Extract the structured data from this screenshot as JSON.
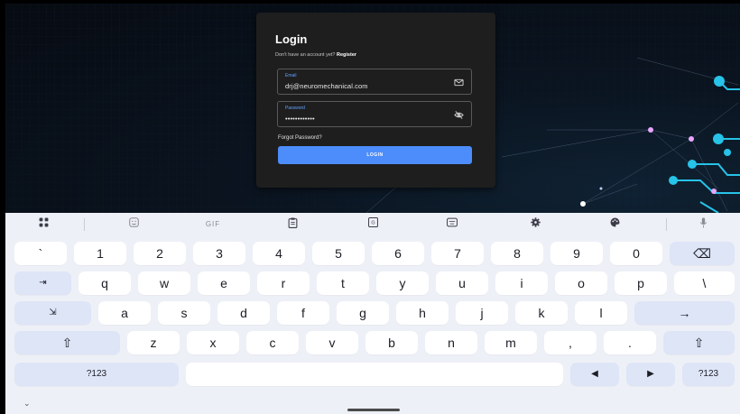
{
  "login": {
    "title": "Login",
    "no_account_text": "Don't have an account yet?",
    "register_link": "Register",
    "email_label": "Email",
    "email_value": "drj@neuromechanical.com",
    "password_label": "Password",
    "password_value": "••••••••••••",
    "forgot_password": "Forgot Password?",
    "login_button": "LOGIN",
    "accent_color": "#4c8dfb"
  },
  "keyboard": {
    "toolbar": {
      "gif_label": "GIF",
      "icons": [
        "apps-grid-icon",
        "sticker-icon",
        "gif-icon",
        "clipboard-icon",
        "translate-icon",
        "keyboard-layout-icon",
        "settings-gear-icon",
        "palette-icon",
        "microphone-icon"
      ]
    },
    "rows": [
      [
        "`",
        "1",
        "2",
        "3",
        "4",
        "5",
        "6",
        "7",
        "8",
        "9",
        "0",
        "⌫"
      ],
      [
        "⇥",
        "q",
        "w",
        "e",
        "r",
        "t",
        "y",
        "u",
        "i",
        "o",
        "p",
        "\\"
      ],
      [
        "⇲",
        "a",
        "s",
        "d",
        "f",
        "g",
        "h",
        "j",
        "k",
        "l",
        "→"
      ],
      [
        "⇧",
        "z",
        "x",
        "c",
        "v",
        "b",
        "n",
        "m",
        ",",
        ".",
        "⇧"
      ],
      [
        "?123",
        "",
        "◀",
        "▶",
        "?123"
      ]
    ],
    "collapse_label": "⌄"
  }
}
